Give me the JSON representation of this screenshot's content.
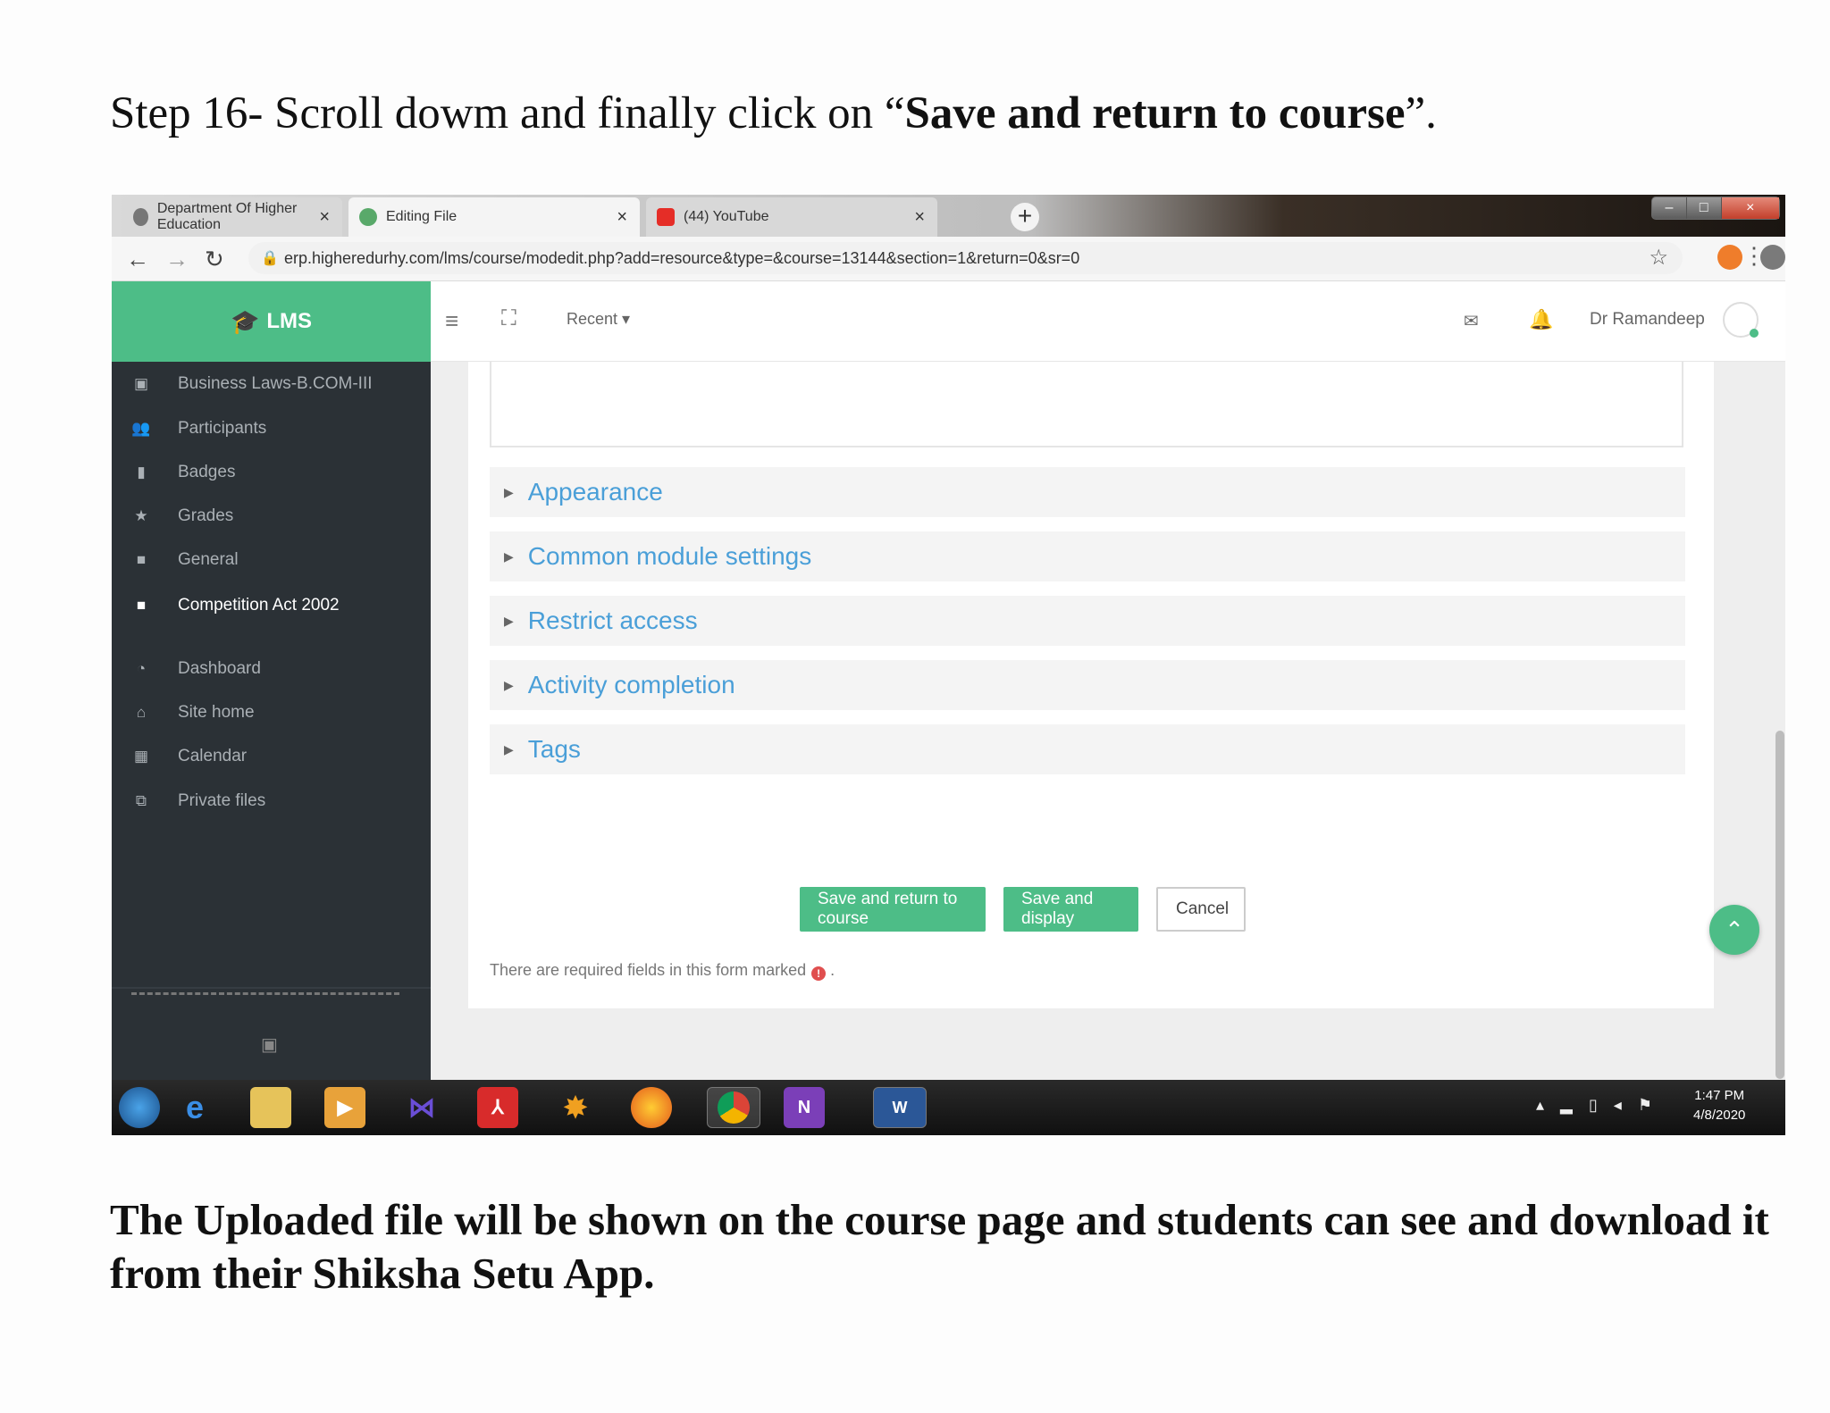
{
  "doc": {
    "heading_prefix": "Step 16- Scroll dowm and finally click on “",
    "heading_bold": "Save and return to course",
    "heading_suffix": "”.",
    "footer": "The Uploaded file will be shown on the course page and students can see and download it from their Shiksha Setu App."
  },
  "browser": {
    "tabs": [
      {
        "label": "Department Of Higher Education",
        "icon": "globe-icon"
      },
      {
        "label": "Editing File",
        "icon": "moodle-icon"
      },
      {
        "label": "(44) YouTube",
        "icon": "youtube-icon"
      }
    ],
    "close_glyph": "×",
    "new_tab_glyph": "+",
    "url": "erp.higheredurhy.com/lms/course/modedit.php?add=resource&type=&course=13144&section=1&return=0&sr=0",
    "window_controls": [
      "–",
      "□",
      "×"
    ]
  },
  "lms": {
    "brand": "LMS",
    "recent": "Recent ▾",
    "user_name": "Dr Ramandeep",
    "sidebar": [
      {
        "label": "Business Laws-B.COM-III",
        "icon": "archive-icon",
        "active": false
      },
      {
        "label": "Participants",
        "icon": "users-icon",
        "active": false
      },
      {
        "label": "Badges",
        "icon": "bookmark-icon",
        "active": false
      },
      {
        "label": "Grades",
        "icon": "star-icon",
        "active": false
      },
      {
        "label": "General",
        "icon": "folder-icon",
        "active": false
      },
      {
        "label": "Competition Act 2002",
        "icon": "folder-icon",
        "active": true
      },
      {
        "label": "Dashboard",
        "icon": "dashboard-icon",
        "active": false
      },
      {
        "label": "Site home",
        "icon": "home-icon",
        "active": false
      },
      {
        "label": "Calendar",
        "icon": "calendar-icon",
        "active": false
      },
      {
        "label": "Private files",
        "icon": "files-icon",
        "active": false
      }
    ],
    "sections": [
      "Appearance",
      "Common module settings",
      "Restrict access",
      "Activity completion",
      "Tags"
    ],
    "buttons": {
      "save_return": "Save and return to course",
      "save_display": "Save and display",
      "cancel": "Cancel"
    },
    "required_note": "There are required fields in this form marked",
    "required_note_end": "."
  },
  "taskbar": {
    "clock_time": "1:47 PM",
    "clock_date": "4/8/2020"
  },
  "colors": {
    "accent": "#4dbd87",
    "sidebar_bg": "#2b3136",
    "link": "#4a9fd8"
  }
}
